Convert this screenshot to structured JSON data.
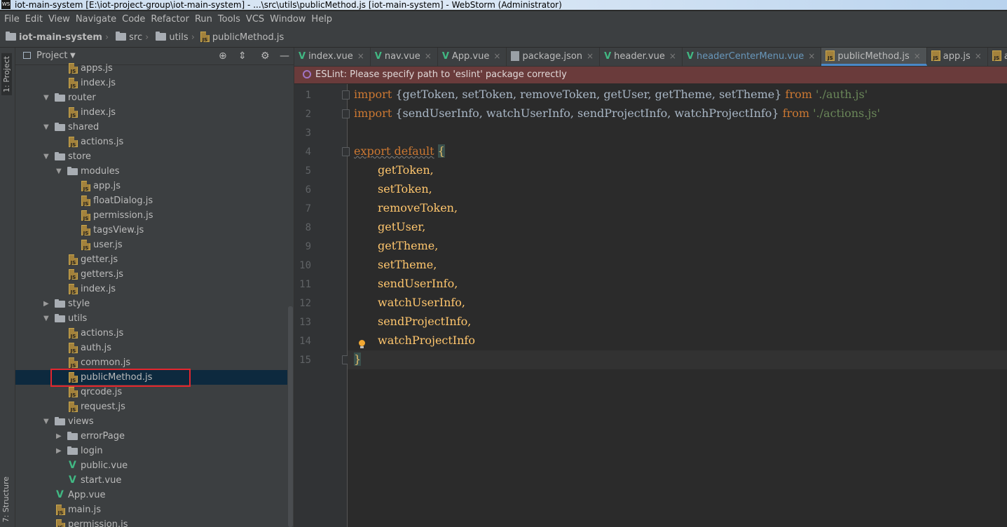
{
  "window": {
    "title": "iot-main-system [E:\\iot-project-group\\iot-main-system] - ...\\src\\utils\\publicMethod.js [iot-main-system] - WebStorm (Administrator)",
    "app_icon_text": "WS"
  },
  "menu": [
    "File",
    "Edit",
    "View",
    "Navigate",
    "Code",
    "Refactor",
    "Run",
    "Tools",
    "VCS",
    "Window",
    "Help"
  ],
  "breadcrumb": [
    "iot-main-system",
    "src",
    "utils",
    "publicMethod.js"
  ],
  "left_strip": {
    "project_tab": "1: Project",
    "structure_tab": "7: Structure"
  },
  "project_panel": {
    "title": "Project",
    "tree": [
      {
        "label": "apps.js",
        "type": "js",
        "depth": 3
      },
      {
        "label": "index.js",
        "type": "js",
        "depth": 3
      },
      {
        "label": "router",
        "type": "folder",
        "depth": 2,
        "expanded": true
      },
      {
        "label": "index.js",
        "type": "js",
        "depth": 3
      },
      {
        "label": "shared",
        "type": "folder",
        "depth": 2,
        "expanded": true
      },
      {
        "label": "actions.js",
        "type": "js",
        "depth": 3
      },
      {
        "label": "store",
        "type": "folder",
        "depth": 2,
        "expanded": true
      },
      {
        "label": "modules",
        "type": "folder",
        "depth": 3,
        "expanded": true
      },
      {
        "label": "app.js",
        "type": "js",
        "depth": 4
      },
      {
        "label": "floatDialog.js",
        "type": "js",
        "depth": 4
      },
      {
        "label": "permission.js",
        "type": "js",
        "depth": 4
      },
      {
        "label": "tagsView.js",
        "type": "js",
        "depth": 4
      },
      {
        "label": "user.js",
        "type": "js",
        "depth": 4
      },
      {
        "label": "getter.js",
        "type": "js",
        "depth": 3
      },
      {
        "label": "getters.js",
        "type": "js",
        "depth": 3
      },
      {
        "label": "index.js",
        "type": "js",
        "depth": 3
      },
      {
        "label": "style",
        "type": "folder",
        "depth": 2,
        "expanded": false
      },
      {
        "label": "utils",
        "type": "folder",
        "depth": 2,
        "expanded": true
      },
      {
        "label": "actions.js",
        "type": "js",
        "depth": 3
      },
      {
        "label": "auth.js",
        "type": "js",
        "depth": 3
      },
      {
        "label": "common.js",
        "type": "js",
        "depth": 3
      },
      {
        "label": "publicMethod.js",
        "type": "js",
        "depth": 3,
        "selected": true
      },
      {
        "label": "qrcode.js",
        "type": "js",
        "depth": 3
      },
      {
        "label": "request.js",
        "type": "js",
        "depth": 3
      },
      {
        "label": "views",
        "type": "folder",
        "depth": 2,
        "expanded": true
      },
      {
        "label": "errorPage",
        "type": "folder",
        "depth": 3,
        "expanded": false
      },
      {
        "label": "login",
        "type": "folder",
        "depth": 3,
        "expanded": false
      },
      {
        "label": "public.vue",
        "type": "vue",
        "depth": 3
      },
      {
        "label": "start.vue",
        "type": "vue",
        "depth": 3
      },
      {
        "label": "App.vue",
        "type": "vue",
        "depth": 2
      },
      {
        "label": "main.js",
        "type": "js",
        "depth": 2
      },
      {
        "label": "permission.js",
        "type": "js",
        "depth": 2
      }
    ]
  },
  "tabs": [
    {
      "label": "index.vue",
      "type": "vue"
    },
    {
      "label": "nav.vue",
      "type": "vue"
    },
    {
      "label": "App.vue",
      "type": "vue"
    },
    {
      "label": "package.json",
      "type": "json"
    },
    {
      "label": "header.vue",
      "type": "vue"
    },
    {
      "label": "headerCenterMenu.vue",
      "type": "vue",
      "modified": true
    },
    {
      "label": "publicMethod.js",
      "type": "js",
      "active": true
    },
    {
      "label": "app.js",
      "type": "js"
    },
    {
      "label": "apps.js",
      "type": "js"
    }
  ],
  "eslint_warning": "ESLint: Please specify path to 'eslint' package correctly",
  "code": {
    "line_numbers": [
      "1",
      "2",
      "3",
      "4",
      "5",
      "6",
      "7",
      "8",
      "9",
      "10",
      "11",
      "12",
      "13",
      "14",
      "15"
    ],
    "line1": {
      "kw": "import",
      "names": "{getToken, setToken, removeToken, getUser, getTheme, setTheme}",
      "from": "from",
      "path": "'./auth.js'"
    },
    "line2": {
      "kw": "import",
      "names": "{sendUserInfo, watchUserInfo, sendProjectInfo, watchProjectInfo}",
      "from": "from",
      "path": "'./actions.js'"
    },
    "line4": {
      "kw": "export default",
      "brace": "{"
    },
    "props": [
      "getToken,",
      "setToken,",
      "removeToken,",
      "getUser,",
      "getTheme,",
      "setTheme,",
      "sendUserInfo,",
      "watchUserInfo,",
      "sendProjectInfo,",
      "watchProjectInfo"
    ],
    "line15": "}"
  },
  "colors": {
    "keyword": "#cc7832",
    "string": "#6a8759",
    "function": "#ffc66d",
    "selection": "#0d293e",
    "highlight_box": "#e3262e",
    "eslint_bar": "#6a3b3b"
  }
}
